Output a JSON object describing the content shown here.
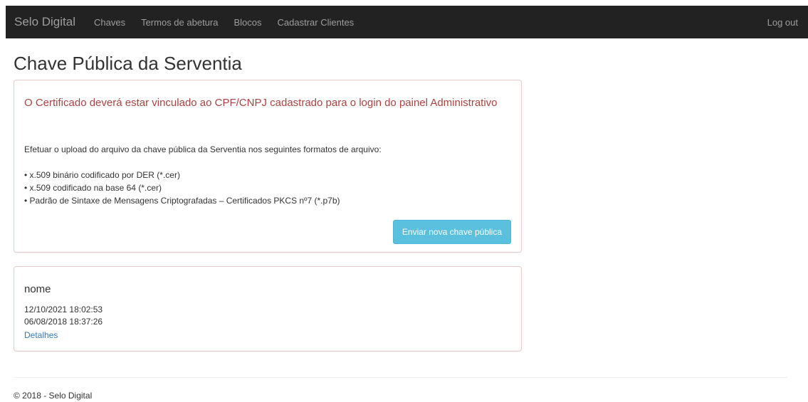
{
  "navbar": {
    "brand": "Selo Digital",
    "items": [
      {
        "label": "Chaves"
      },
      {
        "label": "Termos de abetura"
      },
      {
        "label": "Blocos"
      },
      {
        "label": "Cadastrar Clientes"
      }
    ],
    "logout": "Log out"
  },
  "main": {
    "title": "Chave Pública da Serventia",
    "info_panel": {
      "warning": "O Certificado deverá estar vinculado ao CPF/CNPJ cadastrado para o login do painel Administrativo",
      "instructions": "Efetuar o upload do arquivo da chave pública da Serventia nos seguintes formatos de arquivo:",
      "formats": [
        "• x.509 binário codificado por DER (*.cer)",
        "• x.509 codificado na base 64 (*.cer)",
        "• Padrão de Sintaxe de Mensagens Criptografadas – Certificados PKCS nº7 (*.p7b)"
      ],
      "upload_button": "Enviar nova chave pública"
    },
    "key_panel": {
      "name": "nome",
      "date1": "12/10/2021 18:02:53",
      "date2": "06/08/2018 18:37:26",
      "details_link": "Detalhes"
    }
  },
  "footer": {
    "text": "© 2018 - Selo Digital"
  },
  "colors": {
    "navbar_bg": "#222222",
    "nav_text": "#9d9d9d",
    "warning": "#a94442",
    "button_info": "#5bc0de",
    "link": "#337ab7"
  }
}
